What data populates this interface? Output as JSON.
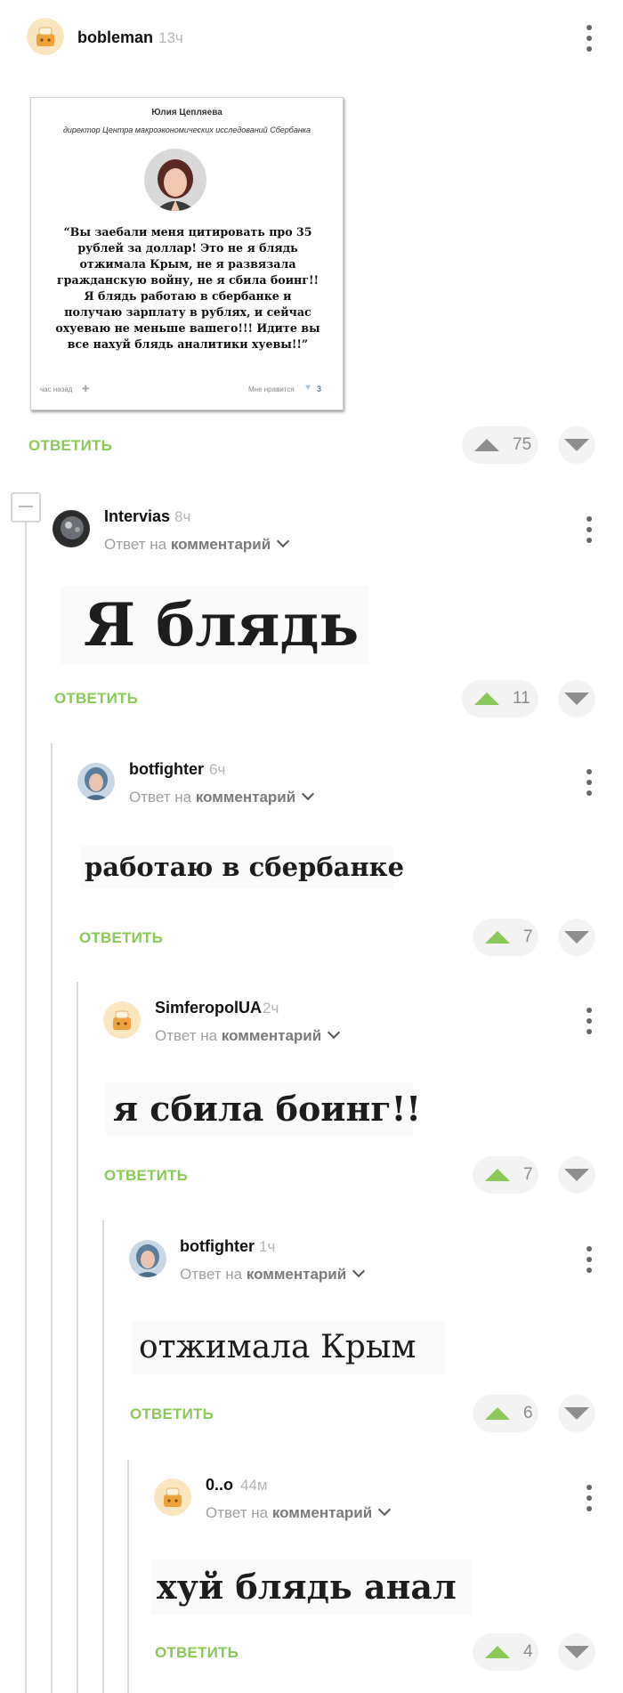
{
  "post": {
    "author": "bobleman",
    "time": "13ч",
    "rating": "75",
    "card": {
      "name": "Юлия Цепляева",
      "position": "директор Центра макроэкономических исследований Сбербанка",
      "quote": "“Вы заебали меня цитировать про 35 рублей за доллар! Это не я блядь отжимала Крым, не я развязала гражданскую войну, не я сбила боинг!! Я блядь работаю в сбербанке и получаю зарплату в рублях, и сейчас охуеваю не меньше вашего!!! Идите вы все нахуй блядь аналитики хуевы!!”",
      "time_label": "час назад",
      "likes_label": "Мне нравится",
      "likes_count": "3"
    }
  },
  "labels": {
    "reply_button": "ОТВЕТИТЬ",
    "reply_to_prefix": "Ответ на",
    "reply_to_link": "комментарий"
  },
  "comments": [
    {
      "author": "Intervias",
      "time": "8ч",
      "image_text": "Я блядь",
      "rating": "11"
    },
    {
      "author": "botfighter",
      "time": "6ч",
      "image_text": "работаю в сбербанке",
      "rating": "7"
    },
    {
      "author": "SimferopolUA",
      "time": "2ч",
      "image_text": "я сбила боинг!!",
      "rating": "7"
    },
    {
      "author": "botfighter",
      "time": "1ч",
      "image_text": "отжимала Крым",
      "rating": "6"
    },
    {
      "author": "0..o",
      "time": "44м",
      "image_text": "хуй блядь анал",
      "rating": "4"
    }
  ],
  "colors": {
    "accent_green": "#8ac858",
    "vote_bg": "#f3f3f3",
    "thread_line": "#dadada"
  }
}
